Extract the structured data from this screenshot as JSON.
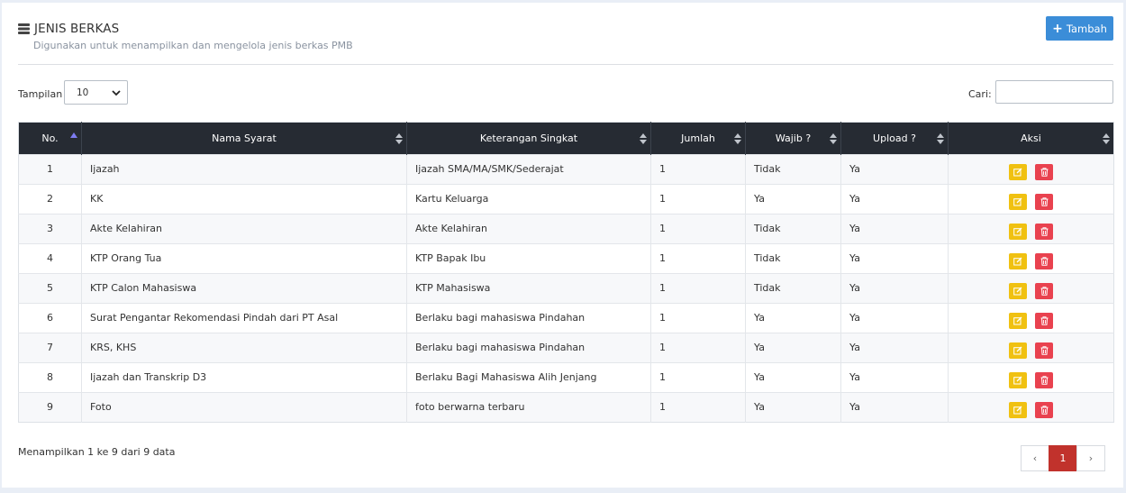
{
  "header": {
    "title": "JENIS BERKAS",
    "subtitle": "Digunakan untuk menampilkan dan mengelola jenis berkas PMB",
    "add_button_label": "Tambah"
  },
  "controls": {
    "length_label": "Tampilan",
    "length_value": "10",
    "search_label": "Cari:",
    "search_value": ""
  },
  "table": {
    "columns": [
      "No.",
      "Nama Syarat",
      "Keterangan Singkat",
      "Jumlah",
      "Wajib ?",
      "Upload ?",
      "Aksi"
    ],
    "rows": [
      [
        "1",
        "Ijazah",
        "Ijazah SMA/MA/SMK/Sederajat",
        "1",
        "Tidak",
        "Ya"
      ],
      [
        "2",
        "KK",
        "Kartu Keluarga",
        "1",
        "Ya",
        "Ya"
      ],
      [
        "3",
        "Akte Kelahiran",
        "Akte Kelahiran",
        "1",
        "Tidak",
        "Ya"
      ],
      [
        "4",
        "KTP Orang Tua",
        "KTP Bapak Ibu",
        "1",
        "Tidak",
        "Ya"
      ],
      [
        "5",
        "KTP Calon Mahasiswa",
        "KTP Mahasiswa",
        "1",
        "Tidak",
        "Ya"
      ],
      [
        "6",
        "Surat Pengantar Rekomendasi Pindah dari PT Asal",
        "Berlaku bagi mahasiswa Pindahan",
        "1",
        "Ya",
        "Ya"
      ],
      [
        "7",
        "KRS, KHS",
        "Berlaku bagi mahasiswa Pindahan",
        "1",
        "Ya",
        "Ya"
      ],
      [
        "8",
        "Ijazah dan Transkrip D3",
        "Berlaku Bagi Mahasiswa Alih Jenjang",
        "1",
        "Ya",
        "Ya"
      ],
      [
        "9",
        "Foto",
        "foto berwarna terbaru",
        "1",
        "Ya",
        "Ya"
      ]
    ]
  },
  "footer": {
    "info": "Menampilkan 1 ke 9 dari 9 data",
    "prev": "‹",
    "current_page": "1",
    "next": "›"
  },
  "colors": {
    "accent": "#3b8dd8",
    "table_header": "#262b33",
    "edit": "#f0c111",
    "delete": "#e9424f",
    "active_page": "#c1322c"
  }
}
